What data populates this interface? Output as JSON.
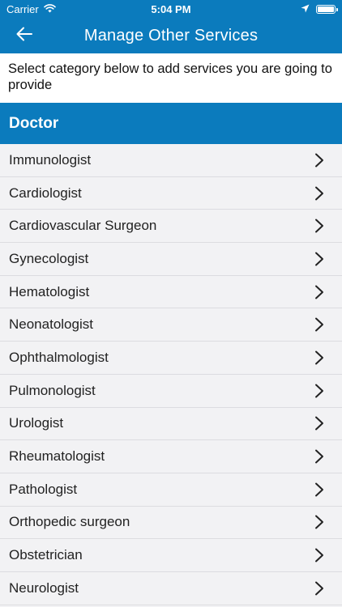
{
  "status_bar": {
    "carrier": "Carrier",
    "time": "5:04 PM"
  },
  "nav": {
    "title": "Manage Other Services",
    "back_icon": "back-arrow-icon"
  },
  "instructions": "Select category below to add services you are going to provide",
  "category": {
    "name": "Doctor"
  },
  "services": [
    {
      "label": "Immunologist"
    },
    {
      "label": "Cardiologist"
    },
    {
      "label": "Cardiovascular Surgeon"
    },
    {
      "label": "Gynecologist"
    },
    {
      "label": "Hematologist"
    },
    {
      "label": "Neonatologist"
    },
    {
      "label": "Ophthalmologist"
    },
    {
      "label": "Pulmonologist"
    },
    {
      "label": "Urologist"
    },
    {
      "label": "Rheumatologist"
    },
    {
      "label": "Pathologist"
    },
    {
      "label": "Orthopedic surgeon"
    },
    {
      "label": "Obstetrician"
    },
    {
      "label": "Neurologist"
    }
  ],
  "colors": {
    "primary": "#0b7bbd",
    "list_bg": "#f2f2f4",
    "divider": "#dcdce0"
  }
}
